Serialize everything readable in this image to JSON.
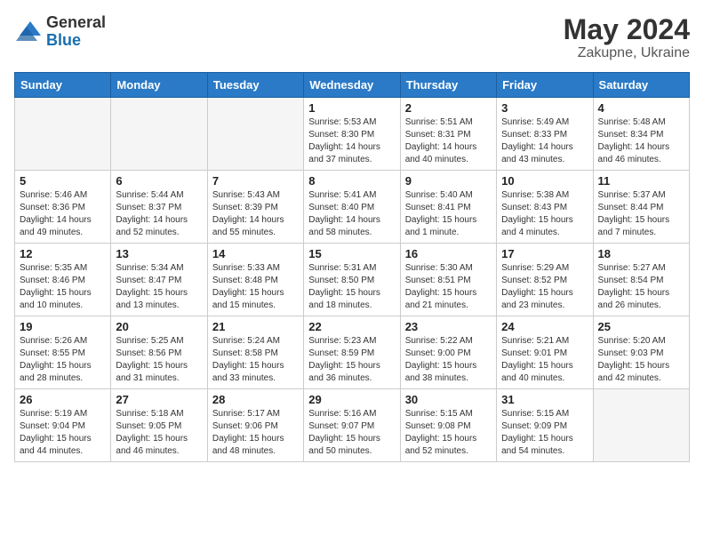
{
  "header": {
    "logo_general": "General",
    "logo_blue": "Blue",
    "month_year": "May 2024",
    "location": "Zakupne, Ukraine"
  },
  "days_of_week": [
    "Sunday",
    "Monday",
    "Tuesday",
    "Wednesday",
    "Thursday",
    "Friday",
    "Saturday"
  ],
  "weeks": [
    [
      {
        "day": "",
        "info": "",
        "empty": true
      },
      {
        "day": "",
        "info": "",
        "empty": true
      },
      {
        "day": "",
        "info": "",
        "empty": true
      },
      {
        "day": "1",
        "info": "Sunrise: 5:53 AM\nSunset: 8:30 PM\nDaylight: 14 hours\nand 37 minutes.",
        "empty": false
      },
      {
        "day": "2",
        "info": "Sunrise: 5:51 AM\nSunset: 8:31 PM\nDaylight: 14 hours\nand 40 minutes.",
        "empty": false
      },
      {
        "day": "3",
        "info": "Sunrise: 5:49 AM\nSunset: 8:33 PM\nDaylight: 14 hours\nand 43 minutes.",
        "empty": false
      },
      {
        "day": "4",
        "info": "Sunrise: 5:48 AM\nSunset: 8:34 PM\nDaylight: 14 hours\nand 46 minutes.",
        "empty": false
      }
    ],
    [
      {
        "day": "5",
        "info": "Sunrise: 5:46 AM\nSunset: 8:36 PM\nDaylight: 14 hours\nand 49 minutes.",
        "empty": false
      },
      {
        "day": "6",
        "info": "Sunrise: 5:44 AM\nSunset: 8:37 PM\nDaylight: 14 hours\nand 52 minutes.",
        "empty": false
      },
      {
        "day": "7",
        "info": "Sunrise: 5:43 AM\nSunset: 8:39 PM\nDaylight: 14 hours\nand 55 minutes.",
        "empty": false
      },
      {
        "day": "8",
        "info": "Sunrise: 5:41 AM\nSunset: 8:40 PM\nDaylight: 14 hours\nand 58 minutes.",
        "empty": false
      },
      {
        "day": "9",
        "info": "Sunrise: 5:40 AM\nSunset: 8:41 PM\nDaylight: 15 hours\nand 1 minute.",
        "empty": false
      },
      {
        "day": "10",
        "info": "Sunrise: 5:38 AM\nSunset: 8:43 PM\nDaylight: 15 hours\nand 4 minutes.",
        "empty": false
      },
      {
        "day": "11",
        "info": "Sunrise: 5:37 AM\nSunset: 8:44 PM\nDaylight: 15 hours\nand 7 minutes.",
        "empty": false
      }
    ],
    [
      {
        "day": "12",
        "info": "Sunrise: 5:35 AM\nSunset: 8:46 PM\nDaylight: 15 hours\nand 10 minutes.",
        "empty": false
      },
      {
        "day": "13",
        "info": "Sunrise: 5:34 AM\nSunset: 8:47 PM\nDaylight: 15 hours\nand 13 minutes.",
        "empty": false
      },
      {
        "day": "14",
        "info": "Sunrise: 5:33 AM\nSunset: 8:48 PM\nDaylight: 15 hours\nand 15 minutes.",
        "empty": false
      },
      {
        "day": "15",
        "info": "Sunrise: 5:31 AM\nSunset: 8:50 PM\nDaylight: 15 hours\nand 18 minutes.",
        "empty": false
      },
      {
        "day": "16",
        "info": "Sunrise: 5:30 AM\nSunset: 8:51 PM\nDaylight: 15 hours\nand 21 minutes.",
        "empty": false
      },
      {
        "day": "17",
        "info": "Sunrise: 5:29 AM\nSunset: 8:52 PM\nDaylight: 15 hours\nand 23 minutes.",
        "empty": false
      },
      {
        "day": "18",
        "info": "Sunrise: 5:27 AM\nSunset: 8:54 PM\nDaylight: 15 hours\nand 26 minutes.",
        "empty": false
      }
    ],
    [
      {
        "day": "19",
        "info": "Sunrise: 5:26 AM\nSunset: 8:55 PM\nDaylight: 15 hours\nand 28 minutes.",
        "empty": false
      },
      {
        "day": "20",
        "info": "Sunrise: 5:25 AM\nSunset: 8:56 PM\nDaylight: 15 hours\nand 31 minutes.",
        "empty": false
      },
      {
        "day": "21",
        "info": "Sunrise: 5:24 AM\nSunset: 8:58 PM\nDaylight: 15 hours\nand 33 minutes.",
        "empty": false
      },
      {
        "day": "22",
        "info": "Sunrise: 5:23 AM\nSunset: 8:59 PM\nDaylight: 15 hours\nand 36 minutes.",
        "empty": false
      },
      {
        "day": "23",
        "info": "Sunrise: 5:22 AM\nSunset: 9:00 PM\nDaylight: 15 hours\nand 38 minutes.",
        "empty": false
      },
      {
        "day": "24",
        "info": "Sunrise: 5:21 AM\nSunset: 9:01 PM\nDaylight: 15 hours\nand 40 minutes.",
        "empty": false
      },
      {
        "day": "25",
        "info": "Sunrise: 5:20 AM\nSunset: 9:03 PM\nDaylight: 15 hours\nand 42 minutes.",
        "empty": false
      }
    ],
    [
      {
        "day": "26",
        "info": "Sunrise: 5:19 AM\nSunset: 9:04 PM\nDaylight: 15 hours\nand 44 minutes.",
        "empty": false
      },
      {
        "day": "27",
        "info": "Sunrise: 5:18 AM\nSunset: 9:05 PM\nDaylight: 15 hours\nand 46 minutes.",
        "empty": false
      },
      {
        "day": "28",
        "info": "Sunrise: 5:17 AM\nSunset: 9:06 PM\nDaylight: 15 hours\nand 48 minutes.",
        "empty": false
      },
      {
        "day": "29",
        "info": "Sunrise: 5:16 AM\nSunset: 9:07 PM\nDaylight: 15 hours\nand 50 minutes.",
        "empty": false
      },
      {
        "day": "30",
        "info": "Sunrise: 5:15 AM\nSunset: 9:08 PM\nDaylight: 15 hours\nand 52 minutes.",
        "empty": false
      },
      {
        "day": "31",
        "info": "Sunrise: 5:15 AM\nSunset: 9:09 PM\nDaylight: 15 hours\nand 54 minutes.",
        "empty": false
      },
      {
        "day": "",
        "info": "",
        "empty": true
      }
    ]
  ]
}
